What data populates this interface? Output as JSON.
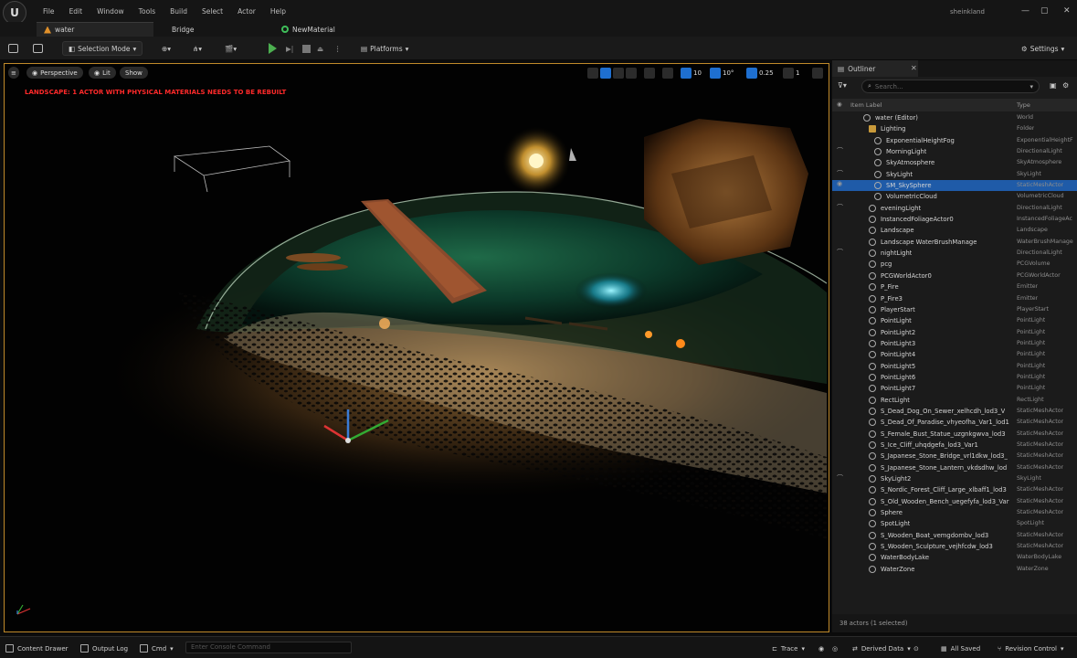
{
  "menu": [
    "File",
    "Edit",
    "Window",
    "Tools",
    "Build",
    "Select",
    "Actor",
    "Help"
  ],
  "project_name": "sheinkland",
  "tabs": [
    {
      "label": "water",
      "active": true
    },
    {
      "label": "Bridge",
      "active": false
    },
    {
      "label": "NewMaterial",
      "active": false
    }
  ],
  "toolbar": {
    "mode": "Selection Mode",
    "platforms": "Platforms",
    "settings": "Settings"
  },
  "viewport": {
    "perspective": "Perspective",
    "lit": "Lit",
    "show": "Show",
    "grid_snap": "10",
    "rot_snap": "10°",
    "scale_snap": "0.25",
    "cam_speed": "1",
    "warning": "LANDSCAPE: 1 ACTOR WITH PHYSICAL MATERIALS NEEDS TO BE REBUILT"
  },
  "outliner": {
    "tab_label": "Outliner",
    "search_placeholder": "Search...",
    "col_label": "Item Label",
    "col_type": "Type",
    "footer": "38 actors (1 selected)",
    "rows": [
      {
        "label": "water (Editor)",
        "type": "World",
        "indent": 2,
        "eye": false,
        "sel": false
      },
      {
        "label": "Lighting",
        "type": "Folder",
        "indent": 3,
        "eye": false,
        "sel": false
      },
      {
        "label": "ExponentialHeightFog",
        "type": "ExponentialHeightF",
        "indent": 4,
        "eye": false,
        "sel": false
      },
      {
        "label": "MorningLight",
        "type": "DirectionalLight",
        "indent": 4,
        "eye": true,
        "sel": false
      },
      {
        "label": "SkyAtmosphere",
        "type": "SkyAtmosphere",
        "indent": 4,
        "eye": false,
        "sel": false
      },
      {
        "label": "SkyLight",
        "type": "SkyLight",
        "indent": 4,
        "eye": true,
        "sel": false
      },
      {
        "label": "SM_SkySphere",
        "type": "StaticMeshActor",
        "indent": 4,
        "eye": true,
        "sel": true
      },
      {
        "label": "VolumetricCloud",
        "type": "VolumetricCloud",
        "indent": 4,
        "eye": false,
        "sel": false
      },
      {
        "label": "eveningLight",
        "type": "DirectionalLight",
        "indent": 3,
        "eye": true,
        "sel": false
      },
      {
        "label": "InstancedFoliageActor0",
        "type": "InstancedFoliageAc",
        "indent": 3,
        "eye": false,
        "sel": false
      },
      {
        "label": "Landscape",
        "type": "Landscape",
        "indent": 3,
        "eye": false,
        "sel": false
      },
      {
        "label": "Landscape WaterBrushManage",
        "type": "WaterBrushManage",
        "indent": 3,
        "eye": false,
        "sel": false
      },
      {
        "label": "nightLight",
        "type": "DirectionalLight",
        "indent": 3,
        "eye": true,
        "sel": false
      },
      {
        "label": "pcg",
        "type": "PCGVolume",
        "indent": 3,
        "eye": false,
        "sel": false
      },
      {
        "label": "PCGWorldActor0",
        "type": "PCGWorldActor",
        "indent": 3,
        "eye": false,
        "sel": false
      },
      {
        "label": "P_Fire",
        "type": "Emitter",
        "indent": 3,
        "eye": false,
        "sel": false
      },
      {
        "label": "P_Fire3",
        "type": "Emitter",
        "indent": 3,
        "eye": false,
        "sel": false
      },
      {
        "label": "PlayerStart",
        "type": "PlayerStart",
        "indent": 3,
        "eye": false,
        "sel": false
      },
      {
        "label": "PointLight",
        "type": "PointLight",
        "indent": 3,
        "eye": false,
        "sel": false
      },
      {
        "label": "PointLight2",
        "type": "PointLight",
        "indent": 3,
        "eye": false,
        "sel": false
      },
      {
        "label": "PointLight3",
        "type": "PointLight",
        "indent": 3,
        "eye": false,
        "sel": false
      },
      {
        "label": "PointLight4",
        "type": "PointLight",
        "indent": 3,
        "eye": false,
        "sel": false
      },
      {
        "label": "PointLight5",
        "type": "PointLight",
        "indent": 3,
        "eye": false,
        "sel": false
      },
      {
        "label": "PointLight6",
        "type": "PointLight",
        "indent": 3,
        "eye": false,
        "sel": false
      },
      {
        "label": "PointLight7",
        "type": "PointLight",
        "indent": 3,
        "eye": false,
        "sel": false
      },
      {
        "label": "RectLight",
        "type": "RectLight",
        "indent": 3,
        "eye": false,
        "sel": false
      },
      {
        "label": "S_Dead_Dog_On_Sewer_xelhcdh_lod3_V",
        "type": "StaticMeshActor",
        "indent": 3,
        "eye": false,
        "sel": false
      },
      {
        "label": "S_Dead_Of_Paradise_vhyeofha_Var1_lod1",
        "type": "StaticMeshActor",
        "indent": 3,
        "eye": false,
        "sel": false
      },
      {
        "label": "S_Female_Bust_Statue_uzgnkgwva_lod3",
        "type": "StaticMeshActor",
        "indent": 3,
        "eye": false,
        "sel": false
      },
      {
        "label": "S_Ice_Cliff_uhqdgefa_lod3_Var1",
        "type": "StaticMeshActor",
        "indent": 3,
        "eye": false,
        "sel": false
      },
      {
        "label": "S_Japanese_Stone_Bridge_vrl1dkw_lod3_",
        "type": "StaticMeshActor",
        "indent": 3,
        "eye": false,
        "sel": false
      },
      {
        "label": "S_Japanese_Stone_Lantern_vkdsdhw_lod",
        "type": "StaticMeshActor",
        "indent": 3,
        "eye": false,
        "sel": false
      },
      {
        "label": "SkyLight2",
        "type": "SkyLight",
        "indent": 3,
        "eye": true,
        "sel": false
      },
      {
        "label": "S_Nordic_Forest_Cliff_Large_xlbaff1_lod3",
        "type": "StaticMeshActor",
        "indent": 3,
        "eye": false,
        "sel": false
      },
      {
        "label": "S_Old_Wooden_Bench_uegefyfa_lod3_Var",
        "type": "StaticMeshActor",
        "indent": 3,
        "eye": false,
        "sel": false
      },
      {
        "label": "Sphere",
        "type": "StaticMeshActor",
        "indent": 3,
        "eye": false,
        "sel": false
      },
      {
        "label": "SpotLight",
        "type": "SpotLight",
        "indent": 3,
        "eye": false,
        "sel": false
      },
      {
        "label": "S_Wooden_Boat_vemgdombv_lod3",
        "type": "StaticMeshActor",
        "indent": 3,
        "eye": false,
        "sel": false
      },
      {
        "label": "S_Wooden_Sculpture_vejhfcdw_lod3",
        "type": "StaticMeshActor",
        "indent": 3,
        "eye": false,
        "sel": false
      },
      {
        "label": "WaterBodyLake",
        "type": "WaterBodyLake",
        "indent": 3,
        "eye": false,
        "sel": false
      },
      {
        "label": "WaterZone",
        "type": "WaterZone",
        "indent": 3,
        "eye": false,
        "sel": false
      }
    ]
  },
  "bottom": {
    "content_drawer": "Content Drawer",
    "output_log": "Output Log",
    "cmd": "Cmd",
    "console_placeholder": "Enter Console Command",
    "trace": "Trace",
    "derived_data": "Derived Data",
    "all_saved": "All Saved",
    "revision_control": "Revision Control"
  },
  "colors": {
    "accent": "#1f5ba8",
    "warning": "#ff2a2a",
    "play": "#4caf50",
    "viewport_border": "#c08a2a"
  }
}
